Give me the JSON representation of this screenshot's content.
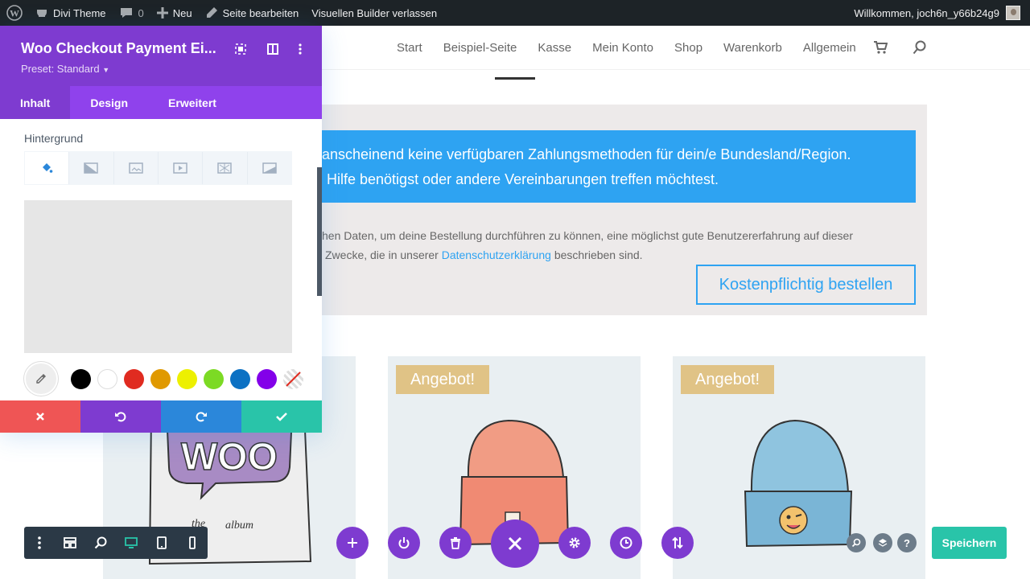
{
  "adminbar": {
    "site_name": "Divi Theme",
    "comments_count": "0",
    "new_label": "Neu",
    "edit_label": "Seite bearbeiten",
    "exit_builder_label": "Visuellen Builder verlassen",
    "welcome": "Willkommen, joch6n_y66b24g9"
  },
  "nav": {
    "items": [
      "Start",
      "Beispiel-Seite",
      "Kasse",
      "Mein Konto",
      "Shop",
      "Warenkorb",
      "Allgemein"
    ]
  },
  "checkout": {
    "notice_line1": "anscheinend keine verfügbaren Zahlungsmethoden für dein/e Bundesland/Region.",
    "notice_line2": "Hilfe benötigst oder andere Vereinbarungen treffen möchtest.",
    "privacy_line1": "hen Daten, um deine Bestellung durchführen zu können, eine möglichst gute Benutzererfahrung auf dieser",
    "privacy_line2_pre": "Zwecke, die in unserer",
    "privacy_link": "Datenschutzerklärung",
    "privacy_line2_post": "beschrieben sind.",
    "order_button": "Kostenpflichtig bestellen"
  },
  "products": {
    "badge_1": "Angebot!",
    "badge_2": "Angebot!"
  },
  "panel": {
    "title": "Woo Checkout Payment Ei...",
    "preset": "Preset: Standard",
    "tabs": [
      "Inhalt",
      "Design",
      "Erweitert"
    ],
    "section_label": "Hintergrund",
    "swatch_colors": [
      "#000000",
      "#ffffff",
      "#e02b20",
      "#e09900",
      "#edf000",
      "#7cda24",
      "#0c71c3",
      "#8300e9"
    ]
  },
  "builder": {
    "save_label": "Speichern",
    "help_label": "?"
  },
  "colors": {
    "divi_purple": "#7e3bd0",
    "divi_purple_light": "#8f42ec",
    "accent_blue": "#2ea3f2",
    "badge_gold": "#e0c386",
    "save_green": "#29c4a9",
    "cancel_red": "#ef5555",
    "redo_blue": "#2b87da"
  }
}
